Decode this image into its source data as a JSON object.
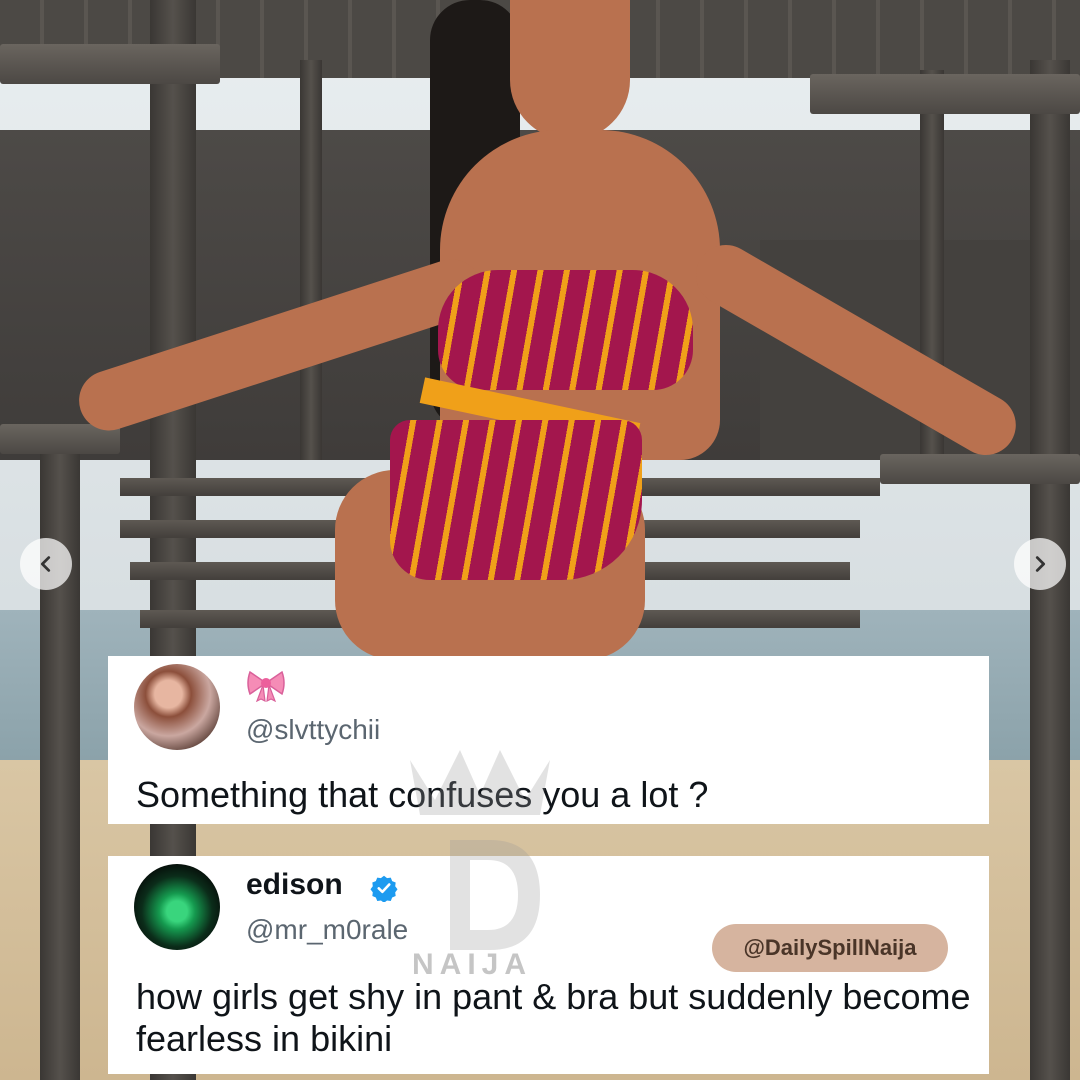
{
  "carousel": {
    "prev_icon": "chevron-left-icon",
    "next_icon": "chevron-right-icon"
  },
  "tweets": [
    {
      "display_name_emoji": "🎀",
      "handle": "@slvttychii",
      "text": "Something that confuses you a lot ?"
    },
    {
      "display_name": "edison",
      "verified": true,
      "handle": "@mr_m0rale",
      "text": "how girls get shy in pant & bra but suddenly become fearless in bikini"
    }
  ],
  "watermark": {
    "tag": "@DailySpillNaija",
    "logo_text": "NAIJA"
  },
  "colors": {
    "card_bg": "#ffffff",
    "text": "#0f1419",
    "handle": "#5b6670",
    "verified": "#1d9bf0",
    "tag_bg": "#d6b49f"
  }
}
